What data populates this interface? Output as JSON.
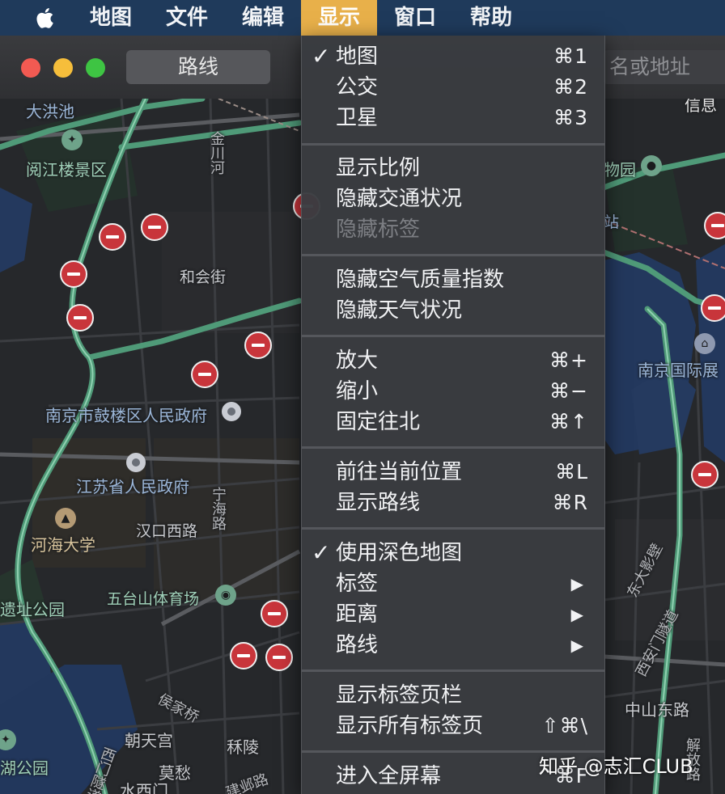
{
  "menubar": {
    "items": [
      "地图",
      "文件",
      "编辑",
      "显示",
      "窗口",
      "帮助"
    ],
    "active": "显示",
    "highlight_color": "#e8b04a",
    "bar_color": "#1f3a5b"
  },
  "window": {
    "route_button": "路线",
    "search_visible": "名或地址"
  },
  "menu": {
    "items": [
      {
        "check": "✓",
        "label": "地图",
        "shortcut": "⌘1"
      },
      {
        "check": "",
        "label": "公交",
        "shortcut": "⌘2"
      },
      {
        "check": "",
        "label": "卫星",
        "shortcut": "⌘3"
      },
      {
        "check": "",
        "label": "显示比例",
        "shortcut": ""
      },
      {
        "check": "",
        "label": "隐藏交通状况",
        "shortcut": ""
      },
      {
        "check": "",
        "label": "隐藏标签",
        "shortcut": "",
        "disabled": true
      },
      {
        "check": "",
        "label": "隐藏空气质量指数",
        "shortcut": ""
      },
      {
        "check": "",
        "label": "隐藏天气状况",
        "shortcut": ""
      },
      {
        "check": "",
        "label": "放大",
        "shortcut": "⌘+"
      },
      {
        "check": "",
        "label": "缩小",
        "shortcut": "⌘−"
      },
      {
        "check": "",
        "label": "固定往北",
        "shortcut": "⌘↑"
      },
      {
        "check": "",
        "label": "前往当前位置",
        "shortcut": "⌘L"
      },
      {
        "check": "",
        "label": "显示路线",
        "shortcut": "⌘R"
      },
      {
        "check": "✓",
        "label": "使用深色地图",
        "shortcut": ""
      },
      {
        "check": "",
        "label": "标签",
        "submenu": "▶"
      },
      {
        "check": "",
        "label": "距离",
        "submenu": "▶"
      },
      {
        "check": "",
        "label": "路线",
        "submenu": "▶"
      },
      {
        "check": "",
        "label": "显示标签页栏",
        "shortcut": ""
      },
      {
        "check": "",
        "label": "显示所有标签页",
        "shortcut": "⇧⌘\\"
      },
      {
        "check": "",
        "label": "进入全屏幕",
        "shortcut": "^⌘F"
      }
    ]
  },
  "map": {
    "labels": {
      "daxiangchi": "大洪池",
      "yuejiang": "阅江楼景区",
      "jinchuanhe": "金川河",
      "hehuijie": "和会街",
      "gulou": "南京市鼓楼区人民政府",
      "jiangsu": "江苏省人民政府",
      "hohai": "河海大学",
      "hankou": "汉口西路",
      "ninghai": "宁海路",
      "yizhi": "遗址公园",
      "wutaishan": "五台山体育场",
      "houjiaqiao": "侯家桥",
      "chaotiangong": "朝天宫",
      "linling": "秝陵",
      "mochou": "莫愁",
      "hugongyuan": "湖公园",
      "ximenmen": "西门隧道",
      "shuiximen": "水西门",
      "jianye": "建邺路",
      "dongwuyuan": "物园",
      "zhan": "站",
      "expo": "南京国际展",
      "dongdayingbi": "东大影壁",
      "xianmen": "西安门隧道",
      "zhongshan": "中山东路",
      "jiefang": "解放路",
      "topright": "信息"
    }
  },
  "watermark": "知乎 @志汇CLUB"
}
